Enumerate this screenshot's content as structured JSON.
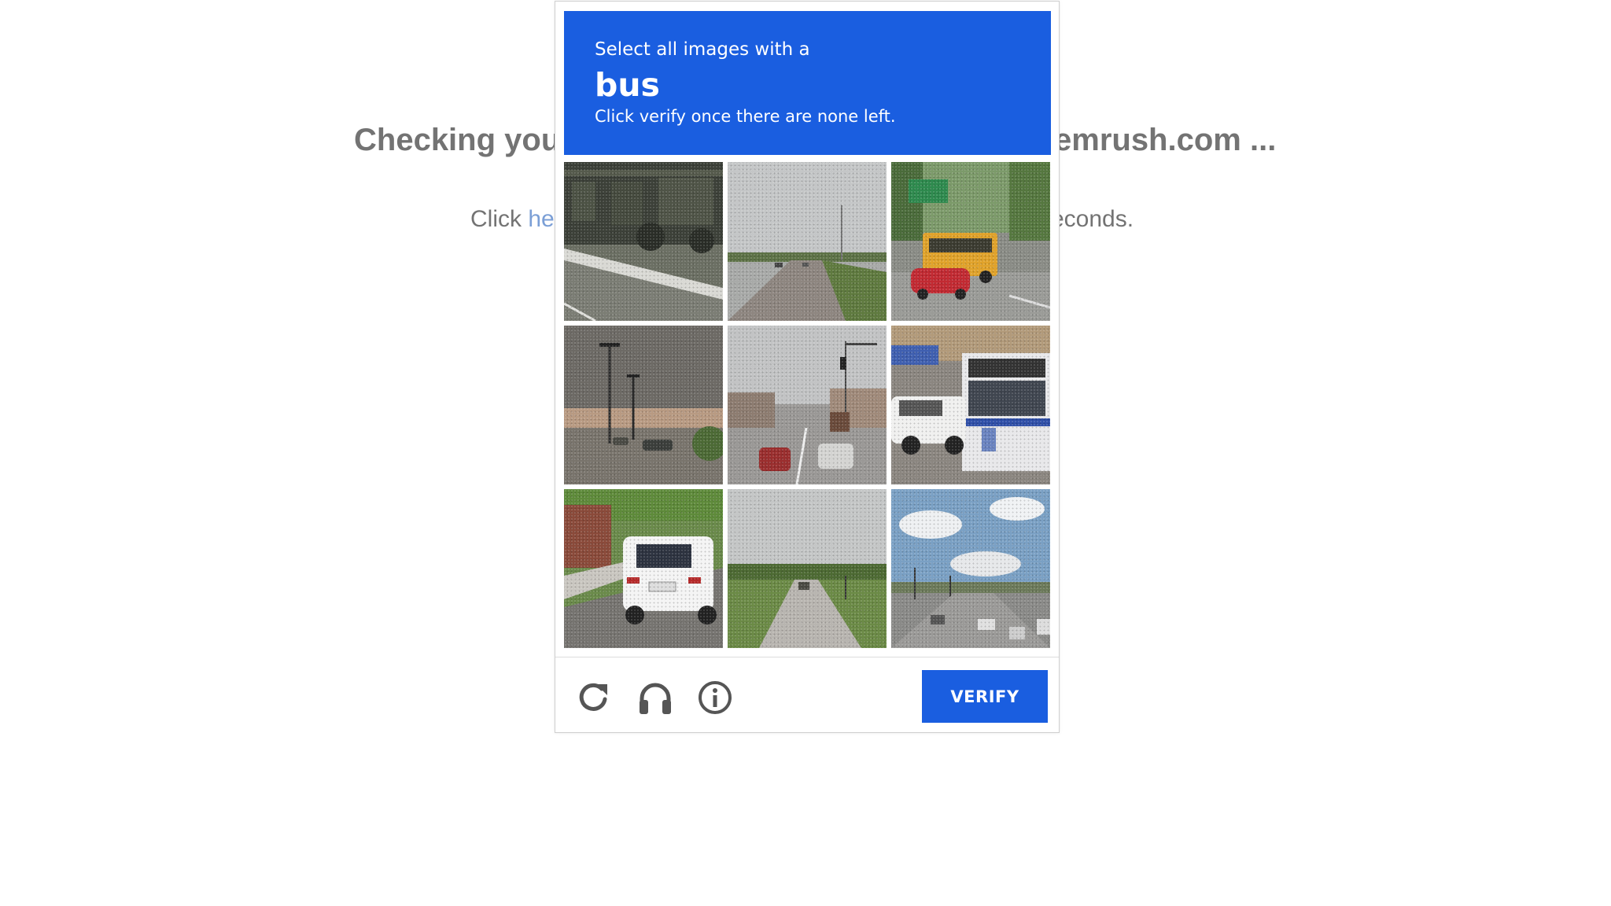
{
  "background_page": {
    "heading_left": "Checking you",
    "heading_right": "emrush.com ...",
    "sub_click": "Click ",
    "sub_link": "he",
    "sub_right": "econds."
  },
  "captcha": {
    "instruction": "Select all images with a",
    "target": "bus",
    "hint": "Click verify once there are none left.",
    "verify_label": "VERIFY",
    "colors": {
      "header": "#1a5ee0",
      "button": "#1a5ee0"
    },
    "tiles": [
      {
        "subject": "train-on-tracks"
      },
      {
        "subject": "highway-road"
      },
      {
        "subject": "school-bus-and-red-car"
      },
      {
        "subject": "parking-lot-lampposts"
      },
      {
        "subject": "city-street-traffic"
      },
      {
        "subject": "city-bus-and-white-truck"
      },
      {
        "subject": "white-suv"
      },
      {
        "subject": "rural-road"
      },
      {
        "subject": "highway-with-clouds"
      }
    ],
    "footer_icons": [
      "reload-icon",
      "audio-headphones-icon",
      "info-icon"
    ]
  }
}
